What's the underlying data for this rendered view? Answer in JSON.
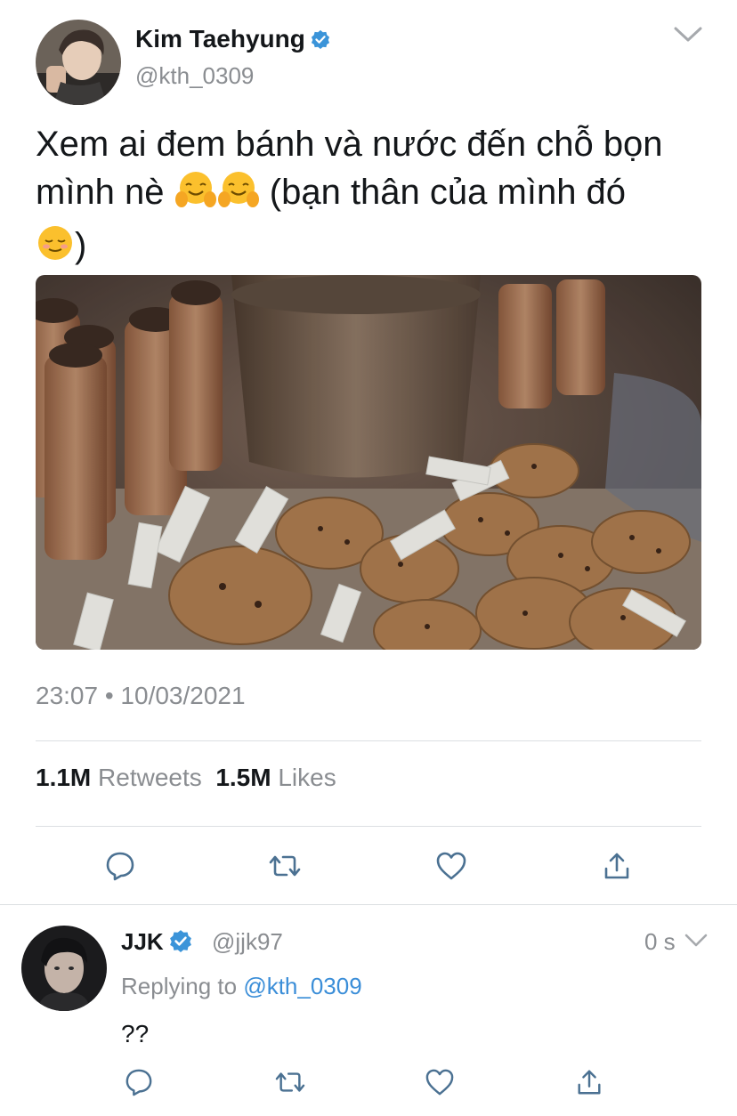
{
  "tweet": {
    "author": {
      "name": "Kim Taehyung",
      "handle": "@kth_0309",
      "verified": true
    },
    "text_line1": "Xem ai đem bánh và nước đến chỗ bọn",
    "text_line2_a": "mình nè ",
    "text_line2_b": " (bạn thân của mình đó",
    "text_line3_b": ")",
    "emojis": [
      "hugging-face",
      "hugging-face",
      "relieved-face"
    ],
    "timestamp": "23:07 • 10/03/2021",
    "stats": {
      "retweets_count": "1.1M",
      "retweets_label": "Retweets",
      "likes_count": "1.5M",
      "likes_label": "Likes"
    },
    "actions": [
      "reply-icon",
      "retweet-icon",
      "like-icon",
      "share-icon"
    ]
  },
  "reply": {
    "author": {
      "name": "JJK",
      "handle": "@jjk97",
      "verified": true
    },
    "time": "0 s",
    "replying_prefix": "Replying to ",
    "replying_mention": "@kth_0309",
    "text": "??",
    "actions": [
      "reply-icon",
      "retweet-icon",
      "like-icon",
      "share-icon"
    ]
  },
  "colors": {
    "verified_blue": "#3b94d9",
    "mention_blue": "#3b8ed8",
    "icon_gray": "#4b7192",
    "secondary_text": "#8a8d91"
  }
}
